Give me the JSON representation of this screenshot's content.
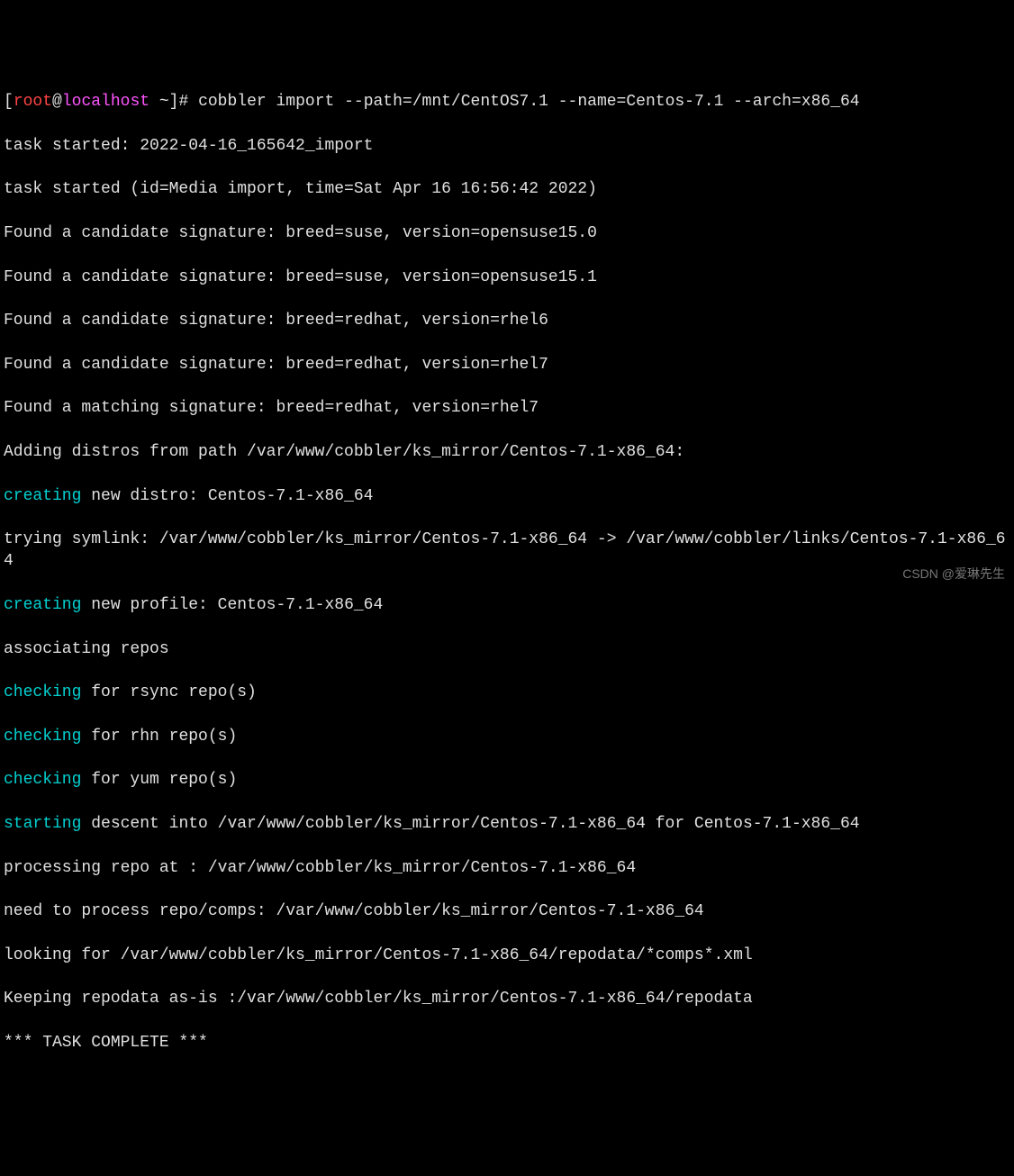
{
  "prompt": {
    "bracket_open": "[",
    "user": "root",
    "at": "@",
    "host": "localhost",
    "tilde": " ~",
    "bracket_close": "]# ",
    "command": "cobbler import --path=/mnt/CentOS7.1 --name=Centos-7.1 --arch=x86_64"
  },
  "lines": {
    "l1": "task started: 2022-04-16_165642_import",
    "l2": "task started (id=Media import, time=Sat Apr 16 16:56:42 2022)",
    "l3": "Found a candidate signature: breed=suse, version=opensuse15.0",
    "l4": "Found a candidate signature: breed=suse, version=opensuse15.1",
    "l5": "Found a candidate signature: breed=redhat, version=rhel6",
    "l6": "Found a candidate signature: breed=redhat, version=rhel7",
    "l7": "Found a matching signature: breed=redhat, version=rhel7",
    "l8": "Adding distros from path /var/www/cobbler/ks_mirror/Centos-7.1-x86_64:",
    "l9a": "creating",
    "l9b": " new distro: Centos-7.1-x86_64",
    "l10": "trying symlink: /var/www/cobbler/ks_mirror/Centos-7.1-x86_64 -> /var/www/cobbler/links/Centos-7.1-x86_64",
    "l11a": "creating",
    "l11b": " new profile: Centos-7.1-x86_64",
    "l12": "associating repos",
    "l13a": "checking",
    "l13b": " for rsync repo(s)",
    "l14a": "checking",
    "l14b": " for rhn repo(s)",
    "l15a": "checking",
    "l15b": " for yum repo(s)",
    "l16a": "starting",
    "l16b": " descent into /var/www/cobbler/ks_mirror/Centos-7.1-x86_64 for Centos-7.1-x86_64",
    "l17": "processing repo at : /var/www/cobbler/ks_mirror/Centos-7.1-x86_64",
    "l18": "need to process repo/comps: /var/www/cobbler/ks_mirror/Centos-7.1-x86_64",
    "l19": "looking for /var/www/cobbler/ks_mirror/Centos-7.1-x86_64/repodata/*comps*.xml",
    "l20": "Keeping repodata as-is :/var/www/cobbler/ks_mirror/Centos-7.1-x86_64/repodata",
    "l21": "*** TASK COMPLETE ***"
  },
  "watermark": "CSDN @爱琳先生"
}
